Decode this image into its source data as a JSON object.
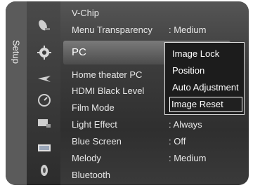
{
  "side_tab": {
    "label": "Setup"
  },
  "menu": {
    "items": [
      {
        "label": "V-Chip",
        "value": ""
      },
      {
        "label": "Menu Transparency",
        "value": ": Medium"
      },
      {
        "label": "PC",
        "value": ""
      },
      {
        "label": "Home theater PC",
        "value": ":"
      },
      {
        "label": "HDMI Black Level",
        "value": ":"
      },
      {
        "label": "Film Mode",
        "value": ":"
      },
      {
        "label": "Light Effect",
        "value": ": Always"
      },
      {
        "label": "Blue Screen",
        "value": ": Off"
      },
      {
        "label": "Melody",
        "value": ": Medium"
      },
      {
        "label": "Bluetooth",
        "value": ""
      }
    ],
    "selected_item": "PC"
  },
  "popup": {
    "items": [
      "Image Lock",
      "Position",
      "Auto Adjustment",
      "Image Reset"
    ],
    "selected": "Image Reset"
  },
  "icons": [
    "satellite-dish-icon",
    "gear-icon",
    "jet-icon",
    "speed-gauge-icon",
    "multi-screen-icon",
    "screen-icon",
    "speaker-icon"
  ]
}
